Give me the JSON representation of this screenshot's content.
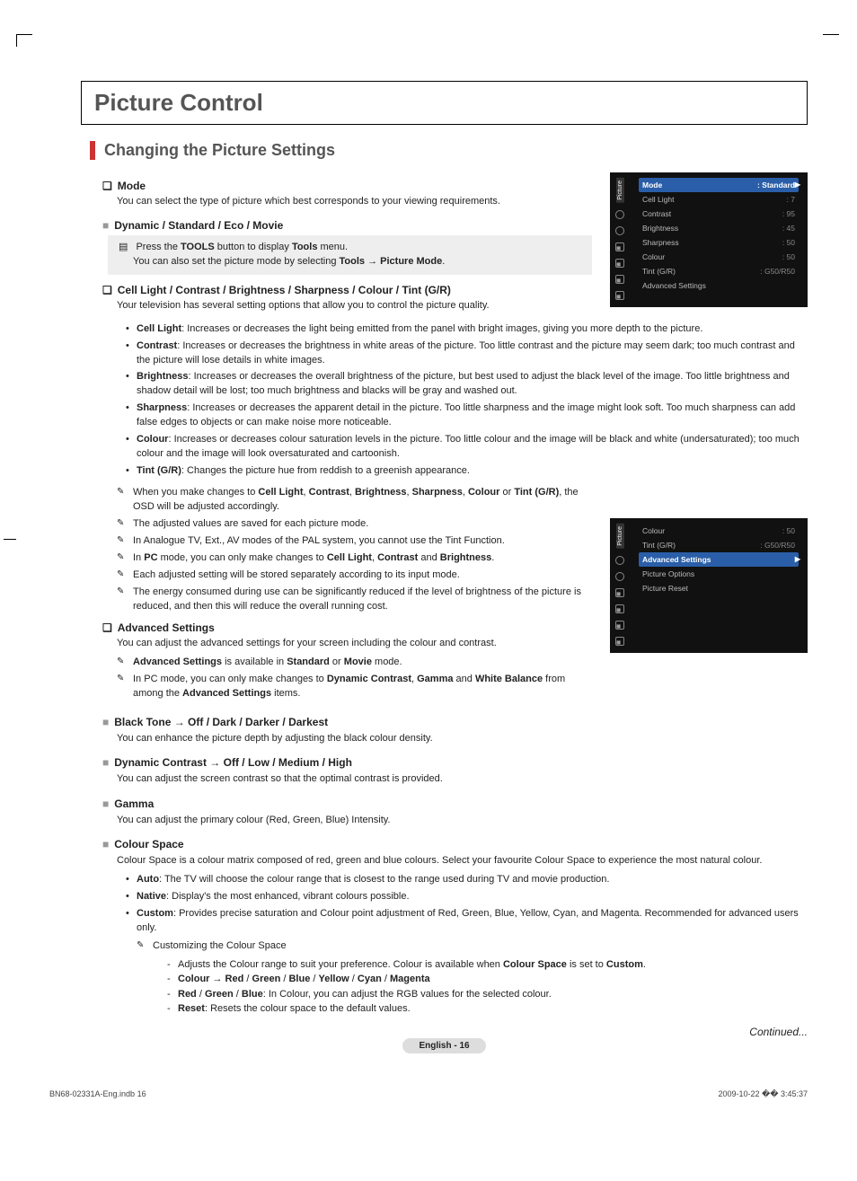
{
  "main_title": "Picture Control",
  "section_title": "Changing the Picture Settings",
  "mode": {
    "heading": "Mode",
    "intro": "You can select the type of picture which best corresponds to your viewing requirements.",
    "options": "Dynamic / Standard / Eco / Movie",
    "tool_line1_pre": "Press the ",
    "tool_line1_b1": "TOOLS",
    "tool_line1_mid": " button to display ",
    "tool_line1_b2": "Tools",
    "tool_line1_post": " menu.",
    "tool_line2_pre": "You can also set the picture mode by selecting ",
    "tool_line2_b": "Tools → Picture Mode",
    "tool_line2_post": "."
  },
  "settings": {
    "heading": "Cell Light / Contrast / Brightness / Sharpness / Colour / Tint (G/R)",
    "intro": "Your television has several setting options that allow you to control the picture quality.",
    "items": [
      {
        "b": "Cell Light",
        "t": ": Increases or decreases the light being emitted from the panel with bright images, giving you more depth to the picture."
      },
      {
        "b": "Contrast",
        "t": ": Increases or decreases the brightness in white areas of the picture. Too little contrast and the picture may seem dark; too much contrast and the picture will lose details in white images."
      },
      {
        "b": "Brightness",
        "t": ": Increases or decreases the overall brightness of the picture, but best used to adjust the black level of the image. Too little brightness and shadow detail will be lost; too much brightness and blacks will be gray and washed out."
      },
      {
        "b": "Sharpness",
        "t": ": Increases or decreases the apparent detail in the picture. Too little sharpness and the image might look soft. Too much sharpness can add false edges to objects or can make noise more noticeable."
      },
      {
        "b": "Colour",
        "t": ": Increases or decreases colour saturation levels in the picture. Too little colour and the image will be black and white (undersaturated); too much colour and the image will look oversaturated and cartoonish."
      },
      {
        "b": "Tint (G/R)",
        "t": ": Changes the picture hue from reddish to a greenish appearance."
      }
    ],
    "note1_pre": "When you make changes to ",
    "note1_b": "Cell Light",
    "note1_s1": ", ",
    "note1_b2": "Contrast",
    "note1_s2": ", ",
    "note1_b3": "Brightness",
    "note1_s3": ", ",
    "note1_b4": "Sharpness",
    "note1_s4": ", ",
    "note1_b5": "Colour",
    "note1_s5": " or ",
    "note1_b6": "Tint (G/R)",
    "note1_post": ", the OSD will be adjusted accordingly.",
    "note2": "The adjusted values are saved for each picture mode.",
    "note3": "In Analogue TV, Ext., AV modes of the PAL system, you cannot use the Tint Function.",
    "note4_pre": "In ",
    "note4_b1": "PC",
    "note4_mid": " mode, you can only make changes to ",
    "note4_b2": "Cell Light",
    "note4_s1": ", ",
    "note4_b3": "Contrast",
    "note4_s2": " and ",
    "note4_b4": "Brightness",
    "note4_post": ".",
    "note5": "Each adjusted setting will be stored separately according to its input mode.",
    "note6": "The energy consumed during use can be significantly reduced if the level of brightness of the picture is reduced, and then this will reduce the overall running cost."
  },
  "advanced": {
    "heading": "Advanced Settings",
    "intro": "You can adjust the advanced settings for your screen including the colour and contrast.",
    "n1_b1": "Advanced Settings",
    "n1_mid": " is available in ",
    "n1_b2": "Standard",
    "n1_or": " or ",
    "n1_b3": "Movie",
    "n1_post": " mode.",
    "n2_pre": "In PC mode, you can only make changes to ",
    "n2_b1": "Dynamic Contrast",
    "n2_s1": ", ",
    "n2_b2": "Gamma",
    "n2_s2": " and ",
    "n2_b3": "White Balance",
    "n2_mid": " from among the ",
    "n2_b4": "Advanced Settings",
    "n2_post": " items."
  },
  "blacktone": {
    "heading": "Black Tone → Off / Dark / Darker / Darkest",
    "body": "You can enhance the picture depth by adjusting the black colour density."
  },
  "dyncontrast": {
    "heading": "Dynamic Contrast → Off / Low / Medium / High",
    "body": "You can adjust the screen contrast so that the optimal contrast is provided."
  },
  "gamma": {
    "heading": "Gamma",
    "body": "You can adjust the primary colour (Red, Green, Blue) Intensity."
  },
  "cspace": {
    "heading": "Colour Space",
    "intro": "Colour Space is a colour matrix composed of red, green and blue colours. Select your favourite Colour Space to experience the most natural colour.",
    "auto_b": "Auto",
    "auto_t": ": The TV will choose the colour range that is closest to the range used during TV and movie production.",
    "native_b": "Native",
    "native_t": ": Display's the most enhanced, vibrant colours possible.",
    "custom_b": "Custom",
    "custom_t": ": Provides precise saturation and Colour point adjustment of Red, Green, Blue, Yellow, Cyan, and Magenta. Recommended for advanced users only.",
    "cust_note": "Customizing the Colour Space",
    "d1_pre": "Adjusts the Colour range to suit your preference. Colour is available when ",
    "d1_b": "Colour Space",
    "d1_mid": " is set to ",
    "d1_b2": "Custom",
    "d1_post": ".",
    "d2_b1": "Colour → Red",
    "d2_s": " / ",
    "d2_b2": "Green",
    "d2_b3": "Blue",
    "d2_b4": "Yellow",
    "d2_b5": "Cyan",
    "d2_b6": "Magenta",
    "d3_b1": "Red",
    "d3_b2": "Green",
    "d3_b3": "Blue",
    "d3_t": ": In Colour, you can adjust the RGB values for the selected colour.",
    "d4_b": "Reset",
    "d4_t": ": Resets the colour space to the default values."
  },
  "osd1": {
    "side": "Picture",
    "rows": [
      {
        "l": "Mode",
        "v": ": Standard",
        "hi": true
      },
      {
        "l": "Cell Light",
        "v": ": 7"
      },
      {
        "l": "Contrast",
        "v": ": 95"
      },
      {
        "l": "Brightness",
        "v": ": 45"
      },
      {
        "l": "Sharpness",
        "v": ": 50"
      },
      {
        "l": "Colour",
        "v": ": 50"
      },
      {
        "l": "Tint (G/R)",
        "v": ": G50/R50"
      },
      {
        "l": "Advanced Settings",
        "v": ""
      }
    ]
  },
  "osd2": {
    "side": "Picture",
    "rows": [
      {
        "l": "Colour",
        "v": ": 50"
      },
      {
        "l": "Tint (G/R)",
        "v": ": G50/R50"
      },
      {
        "l": "Advanced Settings",
        "v": "",
        "hi": true
      },
      {
        "l": "Picture Options",
        "v": ""
      },
      {
        "l": "Picture Reset",
        "v": ""
      }
    ]
  },
  "footer_page": "English - 16",
  "continued": "Continued...",
  "print_left": "BN68-02331A-Eng.indb   16",
  "print_right": "2009-10-22   �� 3:45:37"
}
